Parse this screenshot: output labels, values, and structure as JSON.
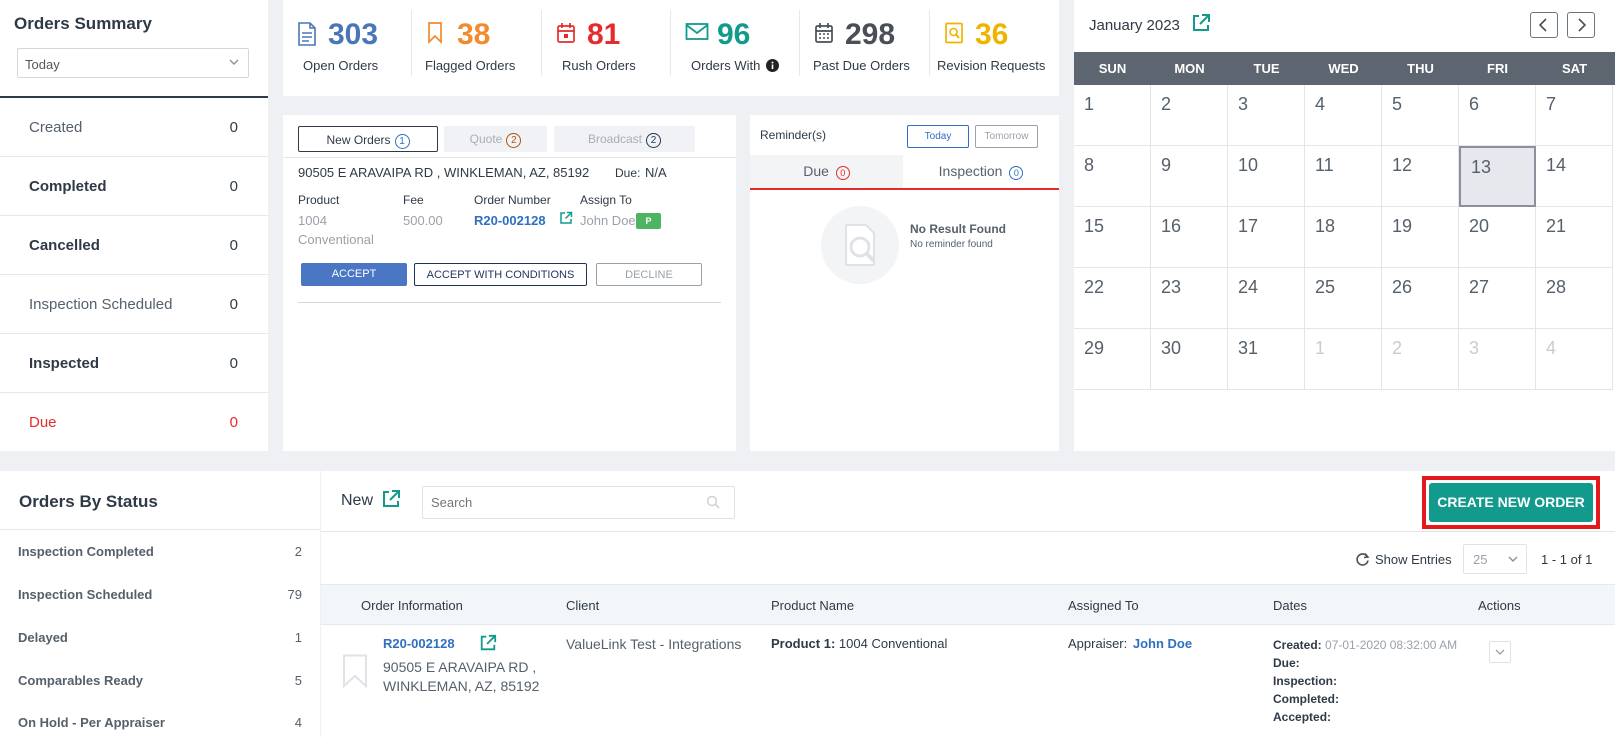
{
  "summary": {
    "title": "Orders Summary",
    "period_value": "Today",
    "rows": [
      {
        "label": "Created",
        "count": "0"
      },
      {
        "label": "Completed",
        "count": "0"
      },
      {
        "label": "Cancelled",
        "count": "0"
      },
      {
        "label": "Inspection Scheduled",
        "count": "0"
      },
      {
        "label": "Inspected",
        "count": "0"
      },
      {
        "label": "Due",
        "count": "0"
      }
    ]
  },
  "stats": [
    {
      "icon": "document-icon",
      "value": "303",
      "label": "Open Orders",
      "color": "#4a76b8"
    },
    {
      "icon": "bookmark-icon",
      "value": "38",
      "label": "Flagged Orders",
      "color": "#f28a2e"
    },
    {
      "icon": "calendar-alert-icon",
      "value": "81",
      "label": "Rush Orders",
      "color": "#e52b2b"
    },
    {
      "icon": "envelope-icon",
      "value": "96",
      "label": "Orders With",
      "color": "#129a8c"
    },
    {
      "icon": "calendar-grid-icon",
      "value": "298",
      "label": "Past Due Orders",
      "color": "#4a4f57"
    },
    {
      "icon": "revision-icon",
      "value": "36",
      "label": "Revision Requests",
      "color": "#f0b400"
    }
  ],
  "orders_panel": {
    "tabs": [
      {
        "label": "New Orders",
        "badge": "1"
      },
      {
        "label": "Quote",
        "badge": "2"
      },
      {
        "label": "Broadcast",
        "badge": "2"
      }
    ],
    "address": "90505 E ARAVAIPA RD , WINKLEMAN, AZ, 85192",
    "due_label": "Due:",
    "due_value": "N/A",
    "product_header": "Product",
    "product_line1": "1004",
    "product_line2": "Conventional",
    "fee_header": "Fee",
    "fee_value": "500.00",
    "order_number_header": "Order Number",
    "order_number": "R20-002128",
    "assign_header": "Assign To",
    "assign_value": "John Doe",
    "assign_badge": "P",
    "accept": "ACCEPT",
    "accept_conditions": "ACCEPT WITH CONDITIONS",
    "decline": "DECLINE"
  },
  "reminder": {
    "title": "Reminder(s)",
    "today": "Today",
    "tomorrow": "Tomorrow",
    "tab_due": "Due",
    "tab_due_count": "0",
    "tab_inspection": "Inspection",
    "tab_inspection_count": "0",
    "empty_title": "No Result Found",
    "empty_sub": "No reminder found"
  },
  "calendar": {
    "title": "January 2023",
    "days": [
      "SUN",
      "MON",
      "TUE",
      "WED",
      "THU",
      "FRI",
      "SAT"
    ],
    "weeks": [
      [
        "1",
        "2",
        "3",
        "4",
        "5",
        "6",
        "7"
      ],
      [
        "8",
        "9",
        "10",
        "11",
        "12",
        "13",
        "14"
      ],
      [
        "15",
        "16",
        "17",
        "18",
        "19",
        "20",
        "21"
      ],
      [
        "22",
        "23",
        "24",
        "25",
        "26",
        "27",
        "28"
      ],
      [
        "29",
        "30",
        "31",
        "1",
        "2",
        "3",
        "4"
      ]
    ],
    "today": "13"
  },
  "by_status": {
    "title": "Orders By Status",
    "rows": [
      {
        "label": "Inspection Completed",
        "count": "2"
      },
      {
        "label": "Inspection Scheduled",
        "count": "79"
      },
      {
        "label": "Delayed",
        "count": "1"
      },
      {
        "label": "Comparables Ready",
        "count": "5"
      },
      {
        "label": "On Hold - Per Appraiser",
        "count": "4"
      }
    ]
  },
  "list": {
    "heading": "New",
    "search_placeholder": "Search",
    "create_button": "CREATE NEW ORDER",
    "show_entries": "Show Entries",
    "entries_value": "25",
    "range": "1 - 1 of 1",
    "headers": [
      "Order Information",
      "Client",
      "Product Name",
      "Assigned To",
      "Dates",
      "Actions"
    ],
    "row": {
      "order_number": "R20-002128",
      "address_line1": "90505 E ARAVAIPA RD ,",
      "address_line2": "WINKLEMAN, AZ, 85192",
      "client": "ValueLink Test - Integrations",
      "product_label": "Product 1:",
      "product_value": "1004 Conventional",
      "appraiser_label": "Appraiser:",
      "appraiser_value": "John Doe",
      "created_label": "Created:",
      "created_value": "07-01-2020 08:32:00 AM",
      "due_label": "Due:",
      "inspection_label": "Inspection:",
      "completed_label": "Completed:",
      "accepted_label": "Accepted:"
    }
  },
  "colors": {
    "teal": "#129a8c",
    "blue_link": "#2f6fc2",
    "highlight_red": "#e3191b",
    "accept_blue": "#4a76c4"
  }
}
